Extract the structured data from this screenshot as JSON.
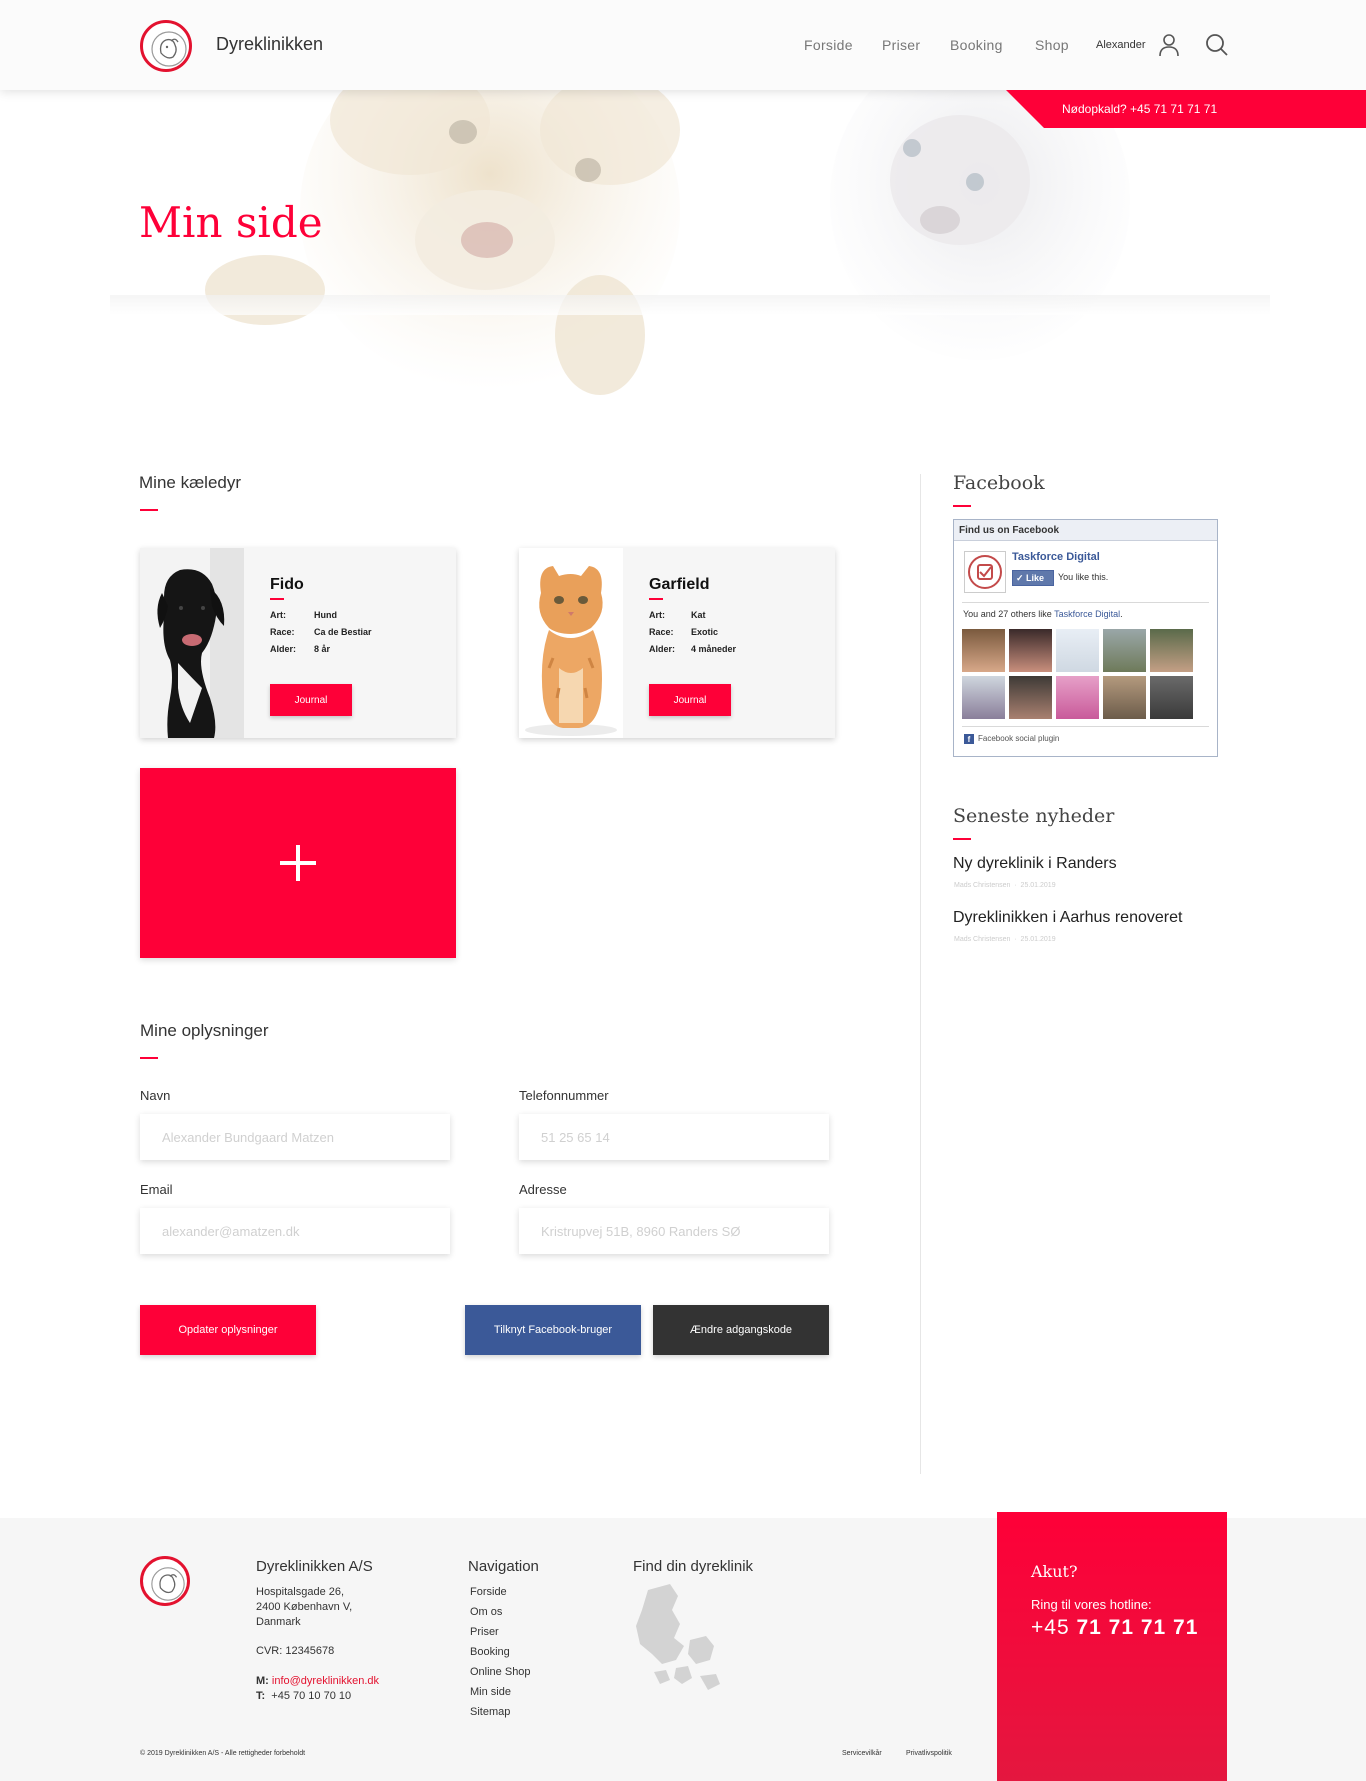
{
  "header": {
    "brand": "Dyreklinikken",
    "nav": [
      "Forside",
      "Priser",
      "Booking",
      "Shop"
    ],
    "user_name": "Alexander",
    "emergency": "Nødopkald?  +45 71 71 71 71"
  },
  "hero": {
    "title": "Min side"
  },
  "pets_section": {
    "title": "Mine kæledyr",
    "pets": [
      {
        "name": "Fido",
        "art_label": "Art:",
        "art": "Hund",
        "race_label": "Race:",
        "race": "Ca de Bestiar",
        "age_label": "Alder:",
        "age": "8 år",
        "button": "Journal"
      },
      {
        "name": "Garfield",
        "art_label": "Art:",
        "art": "Kat",
        "race_label": "Race:",
        "race": "Exotic",
        "age_label": "Alder:",
        "age": "4 måneder",
        "button": "Journal"
      }
    ]
  },
  "info_section": {
    "title": "Mine oplysninger",
    "fields": [
      {
        "label": "Navn",
        "placeholder": "Alexander Bundgaard Matzen"
      },
      {
        "label": "Telefonnummer",
        "placeholder": "51 25 65 14"
      },
      {
        "label": "Email",
        "placeholder": "alexander@amatzen.dk"
      },
      {
        "label": "Adresse",
        "placeholder": "Kristrupvej 51B, 8960 Randers SØ"
      }
    ],
    "buttons": {
      "update": "Opdater oplysninger",
      "facebook": "Tilknyt Facebook-bruger",
      "password": "Ændre adgangskode"
    }
  },
  "sidebar": {
    "facebook_title": "Facebook",
    "fb_widget": {
      "header": "Find us on Facebook",
      "page_name": "Taskforce Digital",
      "like_button": "Like",
      "you_like": "You like this.",
      "others_prefix": "You and 27 others like ",
      "others_page": "Taskforce Digital",
      "others_suffix": ".",
      "footer": "Facebook social plugin"
    },
    "news_title": "Seneste nyheder",
    "news": [
      {
        "title": "Ny dyreklinik i Randers",
        "author": "Mads Christensen",
        "date": "25.01.2019"
      },
      {
        "title": "Dyreklinikken i Aarhus renoveret",
        "author": "Mads Christensen",
        "date": "25.01.2019"
      }
    ]
  },
  "footer": {
    "company_title": "Dyreklinikken A/S",
    "address": [
      "Hospitalsgade 26,",
      "2400 København V,",
      "Danmark"
    ],
    "cvr": "CVR: 12345678",
    "mail_label": "M:",
    "email": "info@dyreklinikken.dk",
    "tel_label": "T:",
    "phone": "+45 70 10 70 10",
    "nav_title": "Navigation",
    "nav_links": [
      "Forside",
      "Om os",
      "Priser",
      "Booking",
      "Online Shop",
      "Min side",
      "Sitemap"
    ],
    "find_title": "Find din dyreklinik",
    "copyright": "© 2019 Dyreklinikken A/S - Alle rettigheder forbeholdt",
    "terms": "Servicevilkår",
    "privacy": "Privatlivspolitik",
    "akut_title": "Akut?",
    "akut_sub": "Ring til vores hotline:",
    "akut_prefix": "+45 ",
    "akut_number": "71 71 71 71"
  },
  "colors": {
    "brand_red": "#fe0038",
    "facebook_blue": "#3b5998",
    "dark": "#333333"
  }
}
